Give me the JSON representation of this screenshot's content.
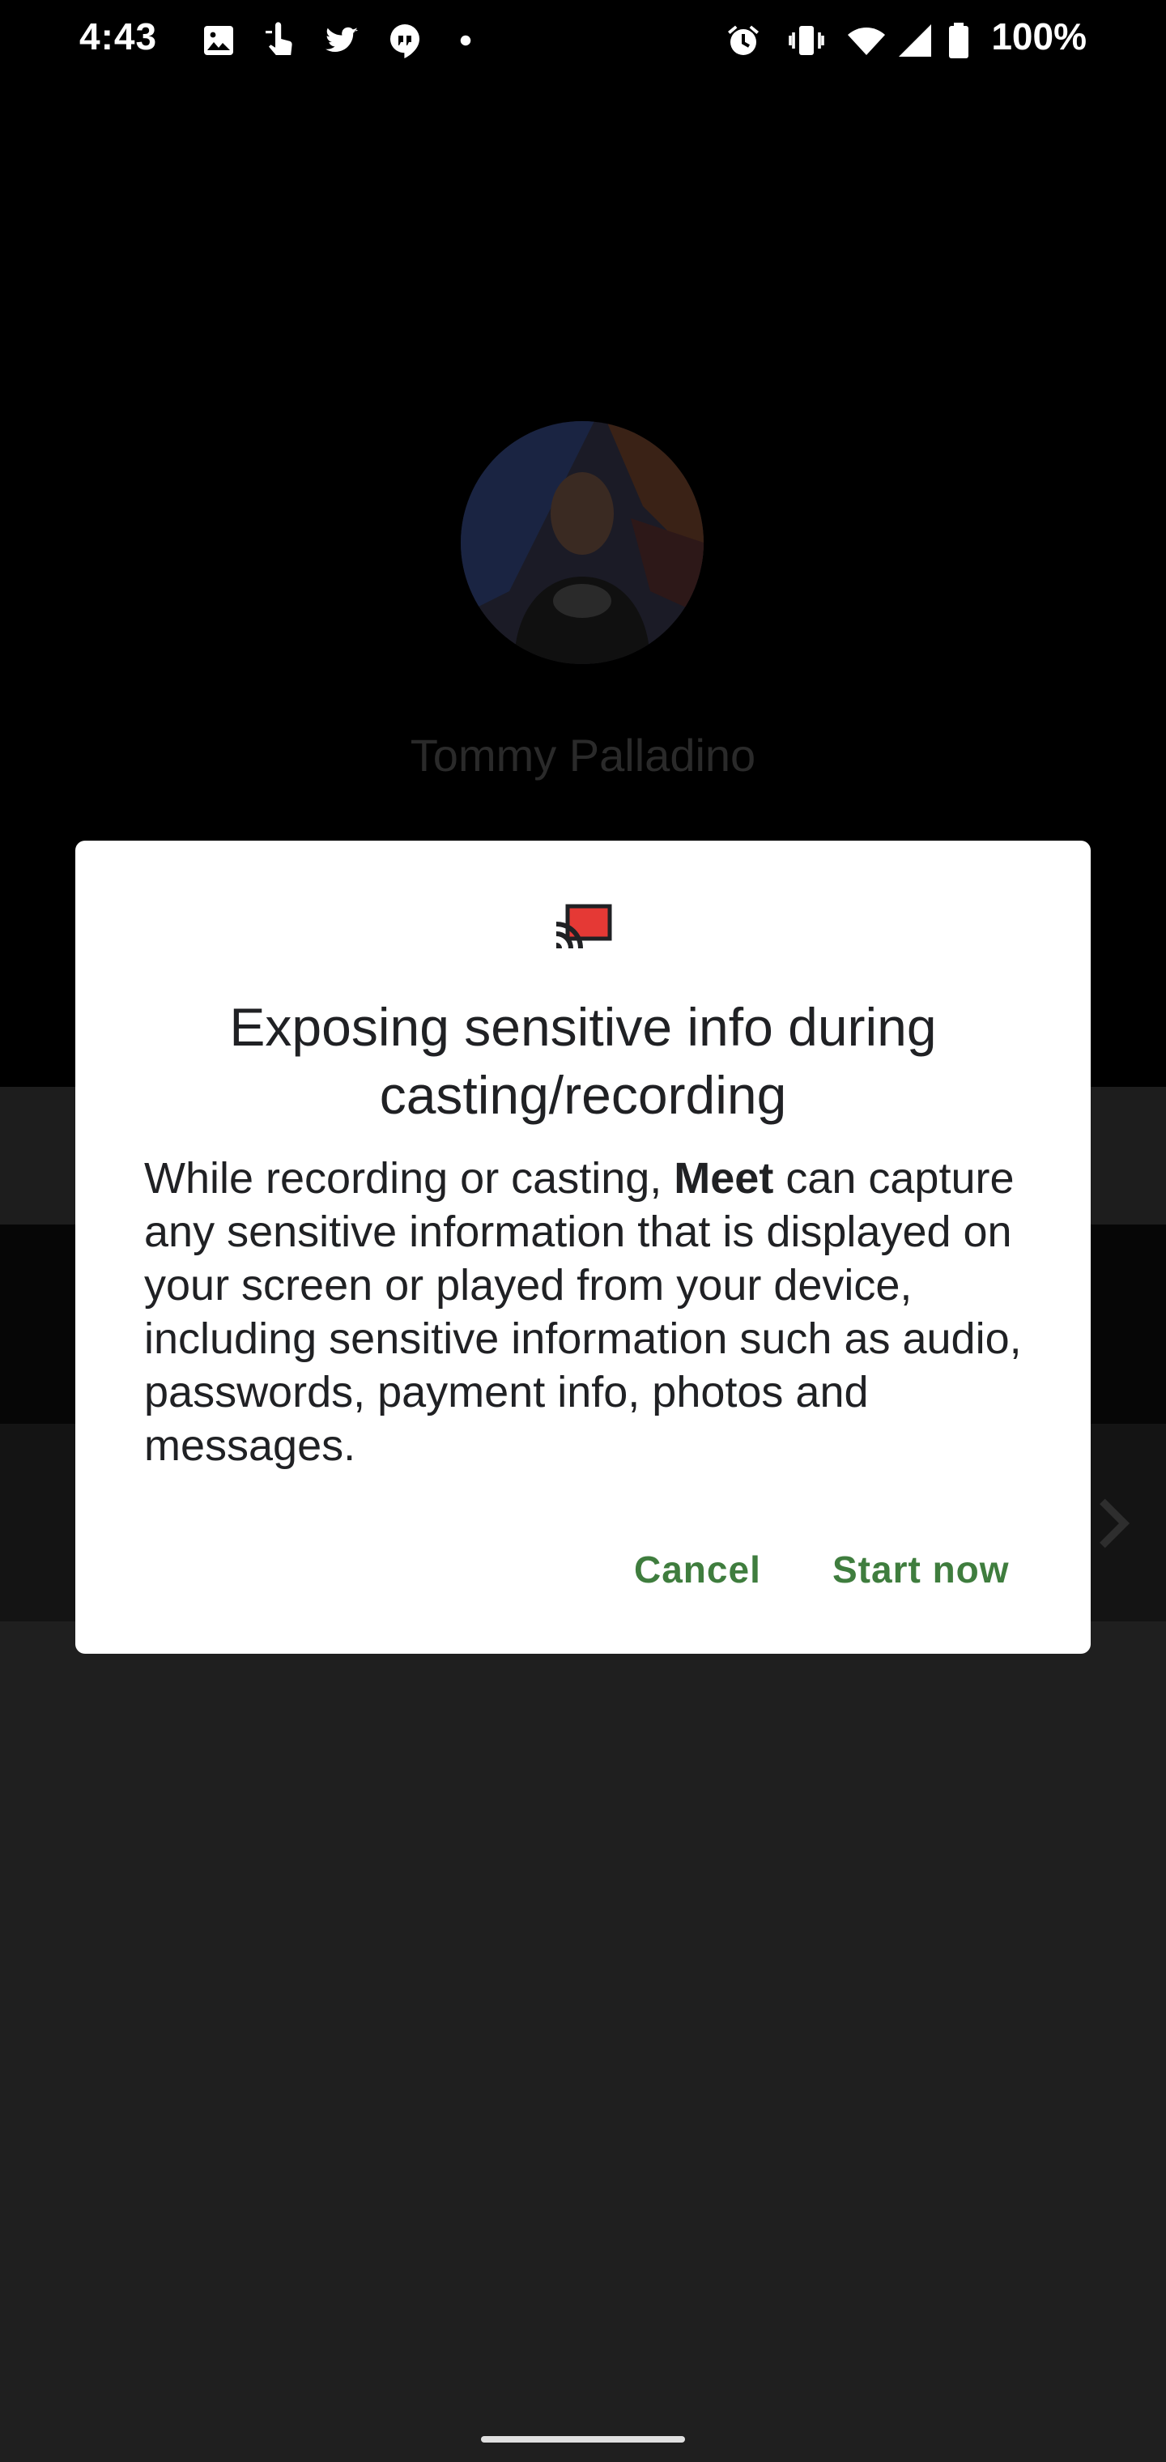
{
  "status_bar": {
    "time": "4:43",
    "battery_percent": "100%",
    "left_icons": [
      "image-icon",
      "touch-icon",
      "twitter-icon",
      "chat-icon",
      "dot-icon"
    ],
    "right_icons": [
      "alarm-icon",
      "vibrate-icon",
      "wifi-icon",
      "signal-icon",
      "battery-icon"
    ]
  },
  "call": {
    "contact_name": "Tommy Palladino"
  },
  "dialog": {
    "icon": "cast-icon",
    "title": "Exposing sensitive info during casting/recording",
    "body_prefix": "While recording or casting, ",
    "body_app": "Meet",
    "body_suffix": " can capture any sensitive information that is displayed on your screen or played from your device, including sensitive information such as audio, passwords, payment info, photos and messages.",
    "cancel_label": "Cancel",
    "start_label": "Start now"
  },
  "colors": {
    "accent": "#3f7d3e",
    "cast_red": "#e53935",
    "dialog_bg": "#ffffff",
    "scrim_bg": "#000000"
  }
}
